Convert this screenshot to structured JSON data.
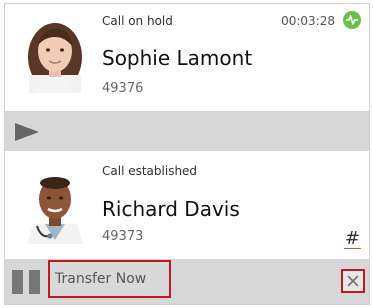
{
  "calls": [
    {
      "status": "Call on hold",
      "name": "Sophie Lamont",
      "extension": "49376",
      "timer": "00:03:28",
      "status_icon": "phone-active-icon",
      "accent_color": "#6cc04a"
    },
    {
      "status": "Call established",
      "name": "Richard Davis",
      "extension": "49373",
      "keypad_label": "#"
    }
  ],
  "hold_bar": {
    "icon": "play-icon"
  },
  "action_bar": {
    "pause_icon": "pause-icon",
    "transfer_label": "Transfer Now",
    "close_icon": "close-icon",
    "highlight_color": "#c4161c"
  }
}
